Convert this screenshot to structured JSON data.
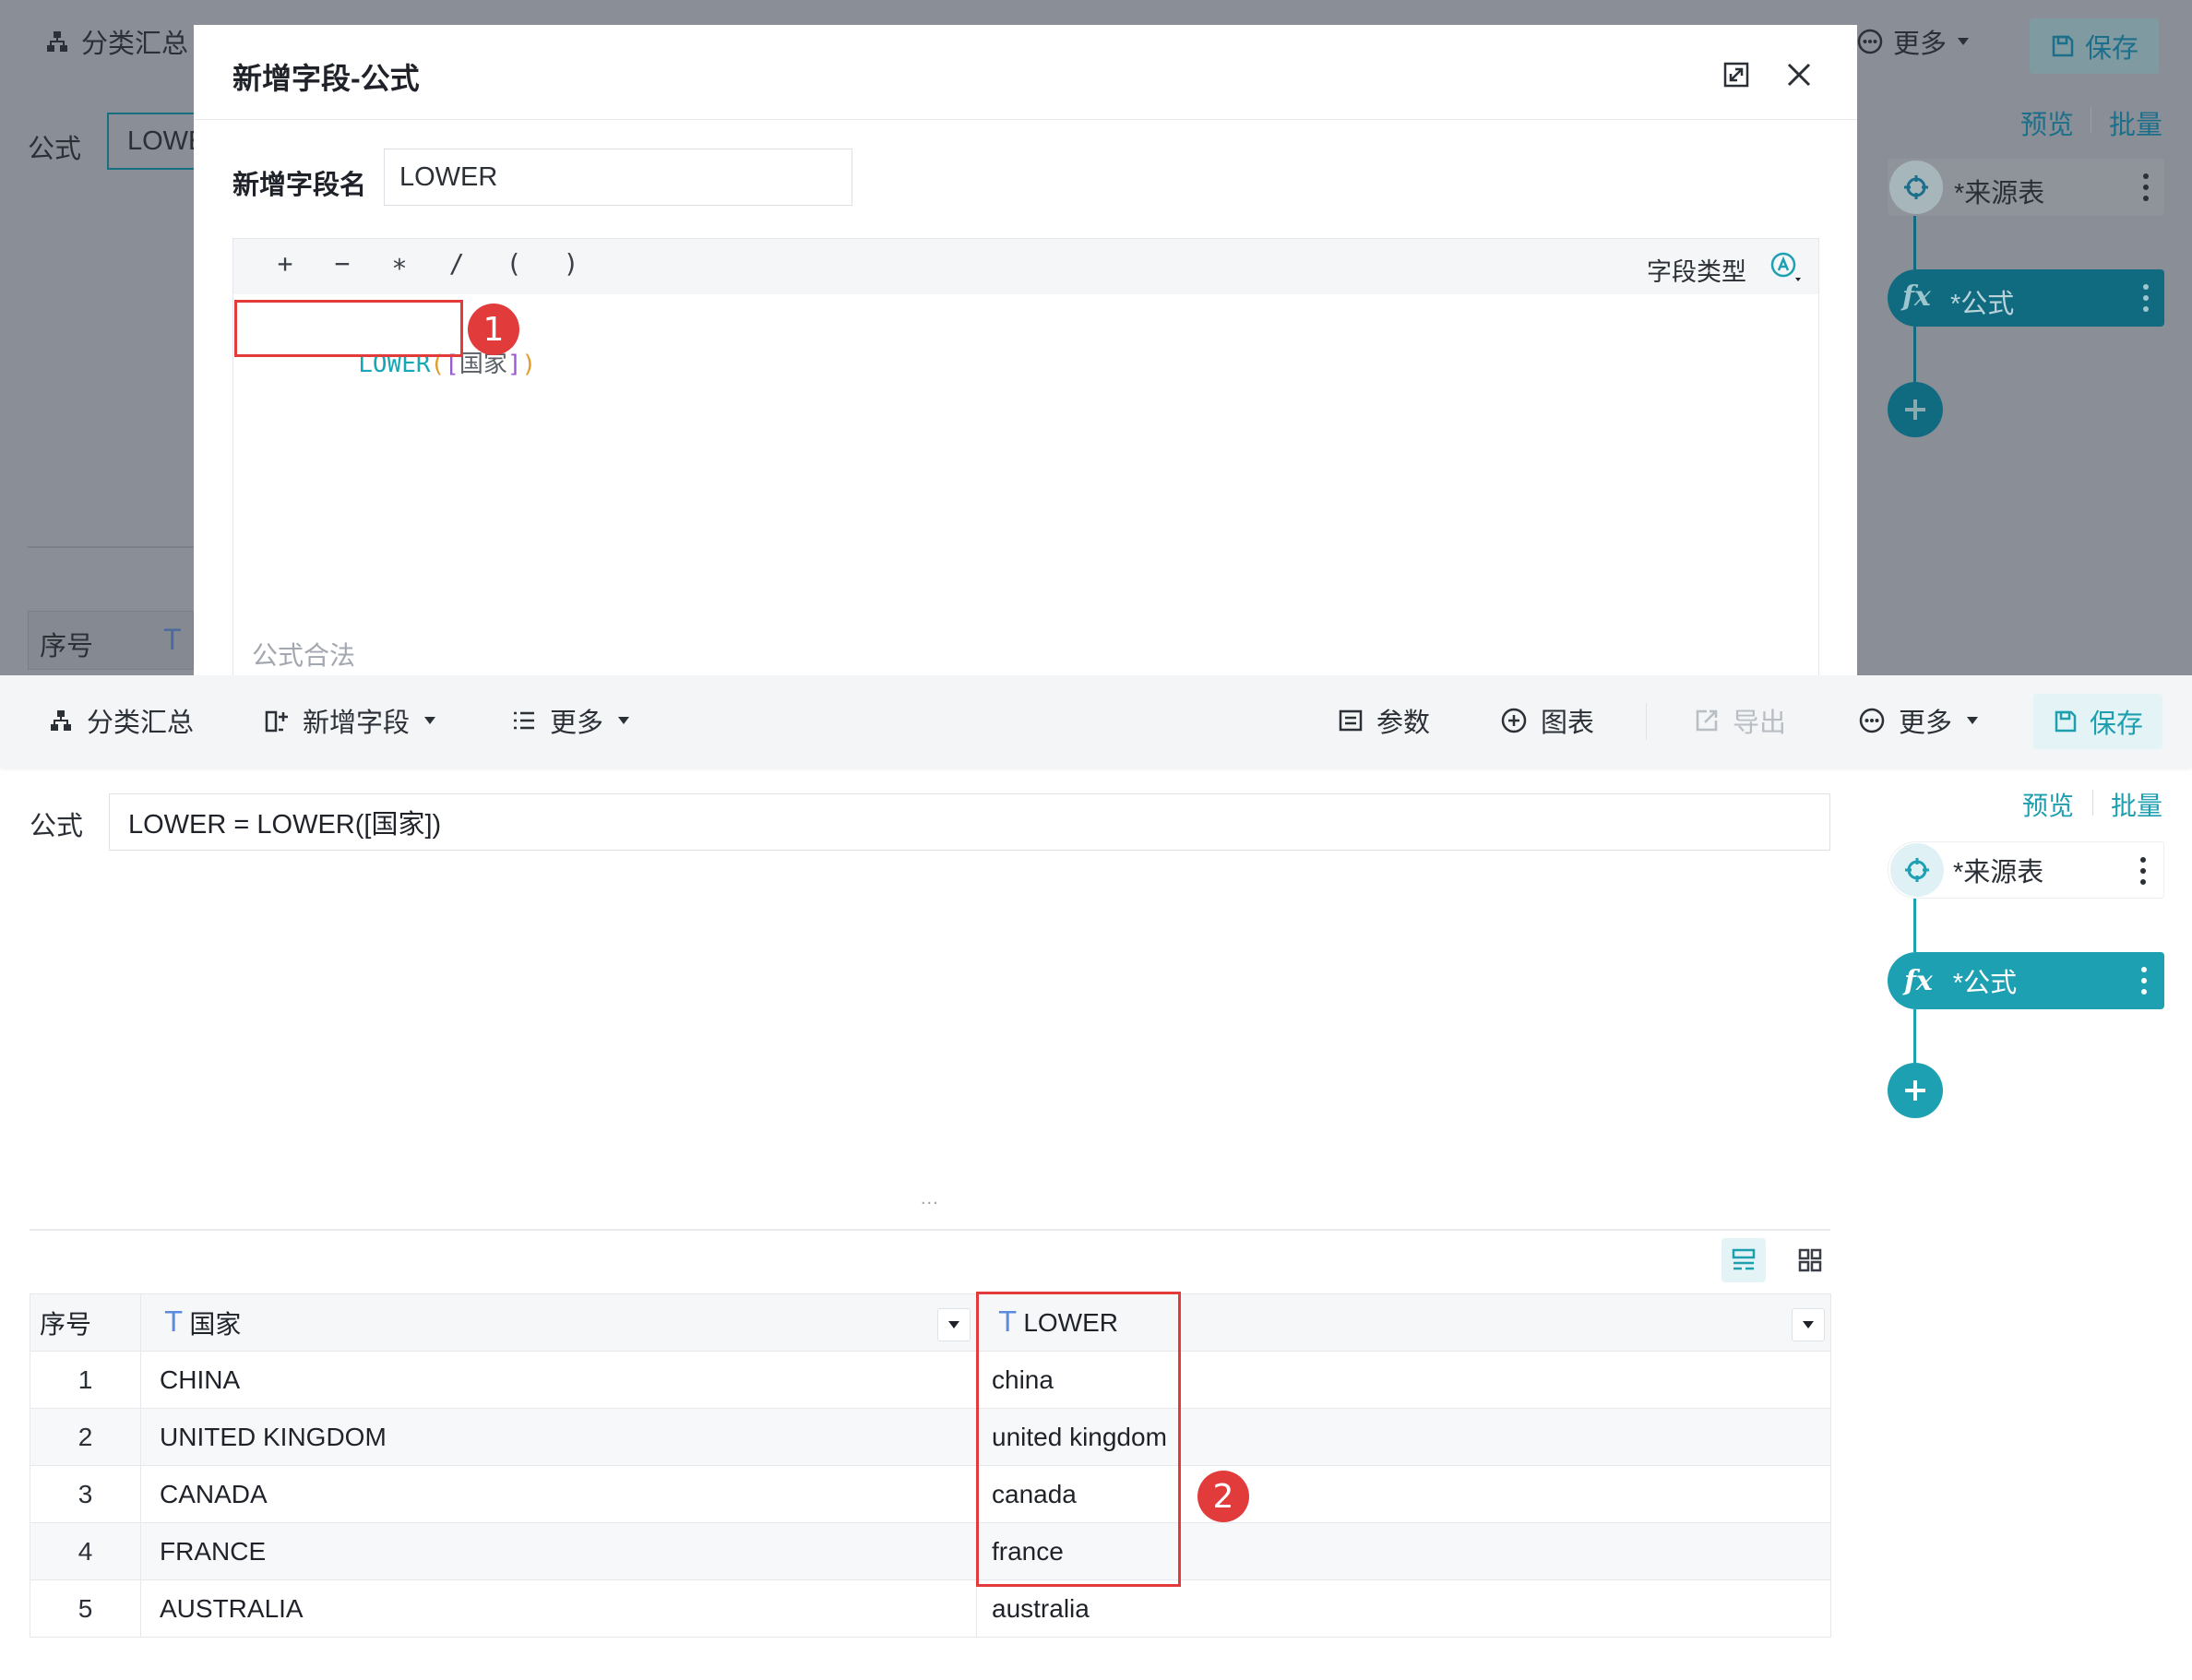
{
  "background": {
    "toolbar": {
      "category_summary": "分类汇总",
      "more": "更多",
      "save": "保存"
    },
    "formula_label": "公式",
    "formula_value_partial": "LOWE",
    "table_header_index": "序号",
    "table_header_type_icon": "T",
    "links": {
      "preview": "预览",
      "batch": "批量"
    },
    "flow": {
      "source": "*来源表",
      "formula": "*公式"
    }
  },
  "modal": {
    "title": "新增字段-公式",
    "field_name_label": "新增字段名",
    "field_name_value": "LOWER",
    "operators": [
      "+",
      "−",
      "∗",
      "/",
      "(",
      ")"
    ],
    "field_type_label": "字段类型",
    "field_type_icon": "text-type-icon",
    "code": {
      "fn": "LOWER",
      "open": "(",
      "lbr": "[",
      "field": "国家",
      "rbr": "]",
      "close": ")"
    },
    "badge": "1",
    "validation_text": "公式合法"
  },
  "toolbar": {
    "category_summary": "分类汇总",
    "add_field": "新增字段",
    "more_left": "更多",
    "params": "参数",
    "chart": "图表",
    "export": "导出",
    "more_right": "更多",
    "save": "保存"
  },
  "formula": {
    "label": "公式",
    "value": "LOWER = LOWER([国家])"
  },
  "splitter": "...",
  "table": {
    "headers": {
      "index": "序号",
      "country": "国家",
      "lower": "LOWER",
      "type_icon": "T"
    },
    "rows": [
      {
        "idx": "1",
        "country": "CHINA",
        "lower": "china"
      },
      {
        "idx": "2",
        "country": "UNITED KINGDOM",
        "lower": "united kingdom"
      },
      {
        "idx": "3",
        "country": "CANADA",
        "lower": "canada"
      },
      {
        "idx": "4",
        "country": "FRANCE",
        "lower": "france"
      },
      {
        "idx": "5",
        "country": "AUSTRALIA",
        "lower": "australia"
      }
    ],
    "badge": "2"
  },
  "right_panel": {
    "preview": "预览",
    "batch": "批量",
    "source_node": "*来源表",
    "formula_node": "*公式"
  },
  "colors": {
    "accent": "#1ea0b3",
    "highlight": "#e23b3b",
    "dim_overlay": "#8a8f97"
  }
}
